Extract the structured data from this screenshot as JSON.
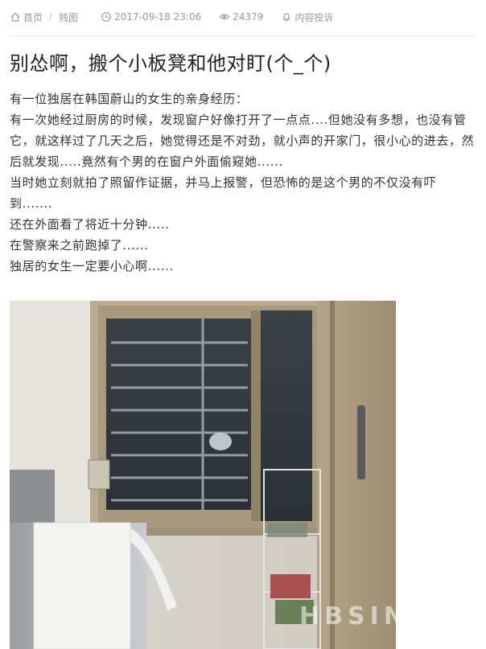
{
  "meta": {
    "home_label": "首页",
    "separator": "/",
    "category_label": "贱图",
    "date": "2017-09-18 23:06",
    "views": "24379",
    "report_label": "内容投诉",
    "icons": {
      "home": "home-icon",
      "clock": "clock-icon",
      "eye": "eye-icon",
      "report": "bell-icon"
    }
  },
  "article": {
    "title": "别怂啊，搬个小板凳和他对盯(个_个)",
    "paragraphs": [
      "有一位独居在韩国蔚山的女生的亲身经历：",
      "有一次她经过厨房的时候，发现窗户好像打开了一点点....但她没有多想，也没有管它，就这样过了几天之后，她觉得还是不对劲，就小声的开家门，很小心的进去，然后就发现.....竟然有个男的在窗户外面偷窥她......",
      "当时她立刻就拍了照留作证据，并马上报警，但恐怖的是这个男的不仅没有吓到.......",
      "还在外面看了将近十分钟.....",
      "在警察来之前跑掉了......",
      "独居的女生一定要小心啊......"
    ],
    "photo_watermark": "HBSING"
  },
  "colors": {
    "meta_text": "#9a9a9a",
    "title_text": "#222222",
    "body_text": "#333333",
    "divider": "#ececec"
  }
}
